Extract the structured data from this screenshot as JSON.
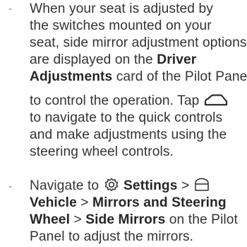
{
  "items": [
    {
      "marker": "-",
      "lines": {
        "l1": {
          "t1": "When your seat is adjusted by"
        },
        "l2": {
          "t1": "the switches mounted on your"
        },
        "l3": {
          "t1": "seat, side mirror adjustment options"
        },
        "l4": {
          "t1": "are displayed on the ",
          "b1": "Driver"
        },
        "l5": {
          "b1": "Adjustments",
          "t1": " card of the Pilot Panel"
        },
        "l6": {
          "t1": "to control the operation. Tap "
        },
        "l7": {
          "t1": "to navigate to the quick controls"
        },
        "l8": {
          "t1": "and make adjustments using the"
        },
        "l9": {
          "t1": "steering wheel controls."
        }
      },
      "icons": {
        "quick_controls": "car-quick-controls-icon"
      }
    },
    {
      "marker": "-",
      "lines": {
        "l1": {
          "t1": "Navigate to ",
          "b1": "Settings",
          "t2": " > "
        },
        "l2": {
          "b1": "Vehicle",
          "t1": " > ",
          "b2": "Mirrors and Steering"
        },
        "l3": {
          "b1": "Wheel",
          "t1": " > ",
          "b2": "Side Mirrors",
          "t2": " on the Pilot"
        },
        "l4": {
          "t1": "Panel to adjust the mirrors."
        }
      },
      "icons": {
        "settings": "settings-gear-icon",
        "vehicle": "vehicle-icon"
      }
    }
  ]
}
